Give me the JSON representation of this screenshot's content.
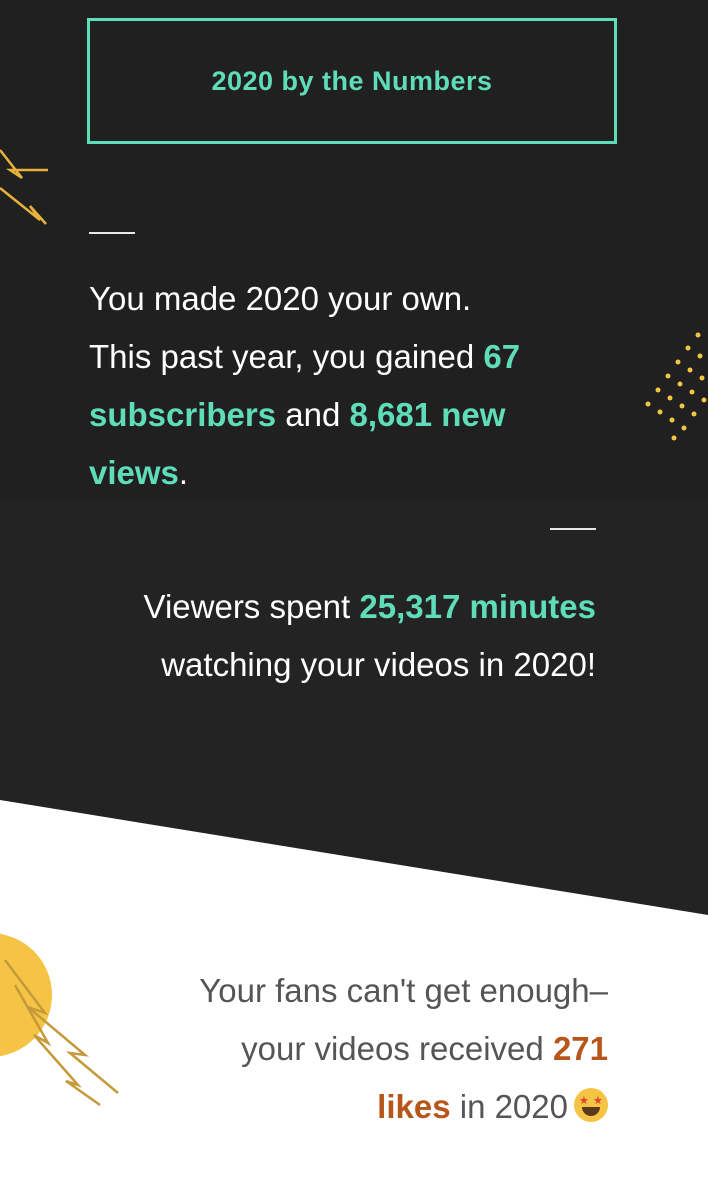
{
  "header": {
    "title": "2020 by the Numbers"
  },
  "stat_subscribers": {
    "line_a": "You made 2020 your own.",
    "line_b_prefix": "This past year, you gained ",
    "subscribers_value": "67 subscribers",
    "connector": " and ",
    "views_value": "8,681 new views",
    "end": "."
  },
  "stat_minutes": {
    "prefix": "Viewers spent ",
    "minutes_value": "25,317 minutes",
    "suffix": " watching your videos in 2020!"
  },
  "stat_likes": {
    "prefix": "Your fans can't get enough–your videos received ",
    "likes_value": "271 likes",
    "suffix": " in 2020",
    "emoji": "star-struck-emoji"
  },
  "colors": {
    "background_dark": "#202020",
    "accent_green": "#5fdcb8",
    "accent_yellow": "#f6c445",
    "accent_orange": "#b8551a",
    "light_background": "#ffffff"
  }
}
